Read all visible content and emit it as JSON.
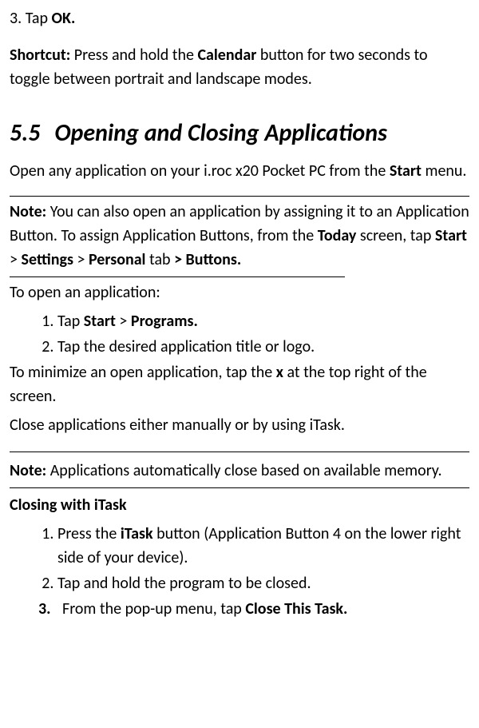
{
  "step3_prefix": "3. Tap ",
  "step3_bold": "OK.",
  "shortcut_label": "Shortcut:",
  "shortcut_text1": " Press and hold the ",
  "shortcut_bold": "Calendar",
  "shortcut_text2": " button for two seconds to toggle between portrait and landscape modes.",
  "heading_num": "5.5",
  "heading_text": "Opening and Closing Applications",
  "open_intro1": "Open any application on your i.roc x20 Pocket PC from the ",
  "open_intro_bold": "Start",
  "open_intro2": " menu.",
  "note1_label": "Note:",
  "note1_text1": " You can also open an application by assigning it to an Application Button. To assign Application Buttons, from the ",
  "note1_b1": "Today",
  "note1_text2": " screen, tap ",
  "note1_b2": "Start",
  "note1_gt": " > ",
  "note1_b3": "Settings",
  "note1_b4": "Personal",
  "note1_text3": " tab ",
  "note1_b5": "> Buttons.",
  "open_app_title": "To open an application:",
  "open_li1_a": "Tap ",
  "open_li1_b": "Start",
  "open_li1_gt": " > ",
  "open_li1_c": "Programs.",
  "open_li2": "Tap the desired application title or logo.",
  "minimize1": "To minimize an open application, tap the ",
  "minimize_b": "x",
  "minimize2": " at the top right of the screen.",
  "close_line": "Close applications either manually or by using iTask.",
  "note2_label": "Note:",
  "note2_text": " Applications automatically close based on available memory.",
  "itask_heading": "Closing with iTask",
  "it_li1_a": "Press the ",
  "it_li1_b": "iTask",
  "it_li1_c": " button (Application Button 4 on the lower right side of your device).",
  "it_li2": "Tap and hold the program to be closed.",
  "it_li3_num": "3.",
  "it_li3_a": "From the pop-up menu, tap ",
  "it_li3_b": "Close This Task."
}
